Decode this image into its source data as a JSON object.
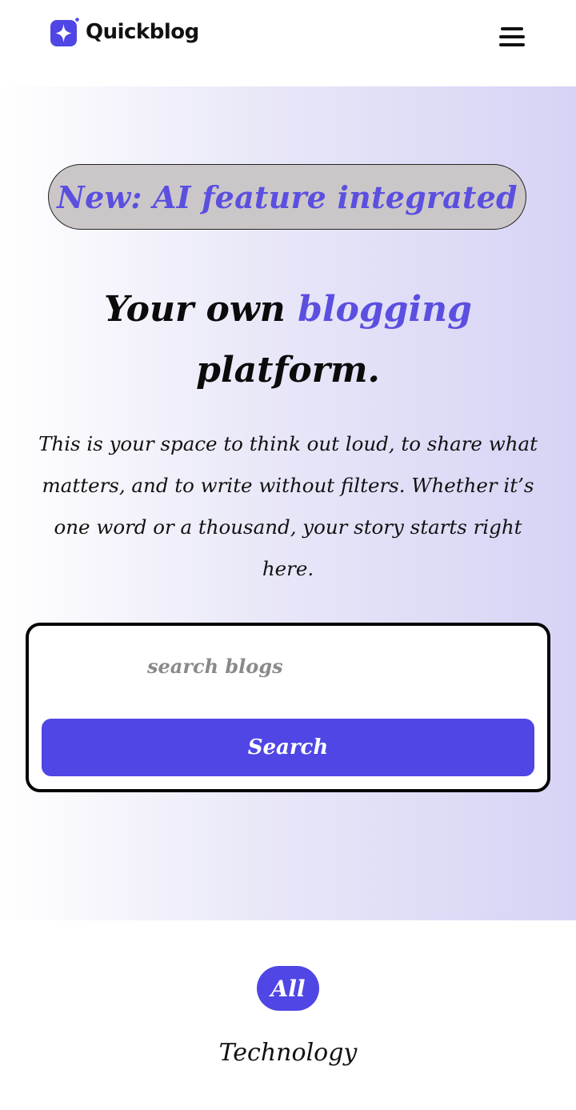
{
  "header": {
    "logo_text": "Quickblog",
    "logo_icon": "sparkle-star-icon",
    "menu_icon": "hamburger-menu-icon"
  },
  "hero": {
    "badge_text": "New: AI feature integrated",
    "headline_part1": "Your own ",
    "headline_accent": "blogging",
    "headline_part2": "platform.",
    "description": "This is your space to think out loud, to share what matters, and to write without filters. Whether it’s one word or a thousand, your story starts right here."
  },
  "search": {
    "placeholder": "search blogs",
    "value": "",
    "button_label": "Search"
  },
  "categories": {
    "items": [
      "All",
      "Technology"
    ],
    "selected": "All"
  },
  "colors": {
    "accent": "#4f46e5",
    "accent_text": "#5b4fe0",
    "badge_background": "#cbc7c8",
    "hero_gradient_end": "#d6d3f5"
  }
}
